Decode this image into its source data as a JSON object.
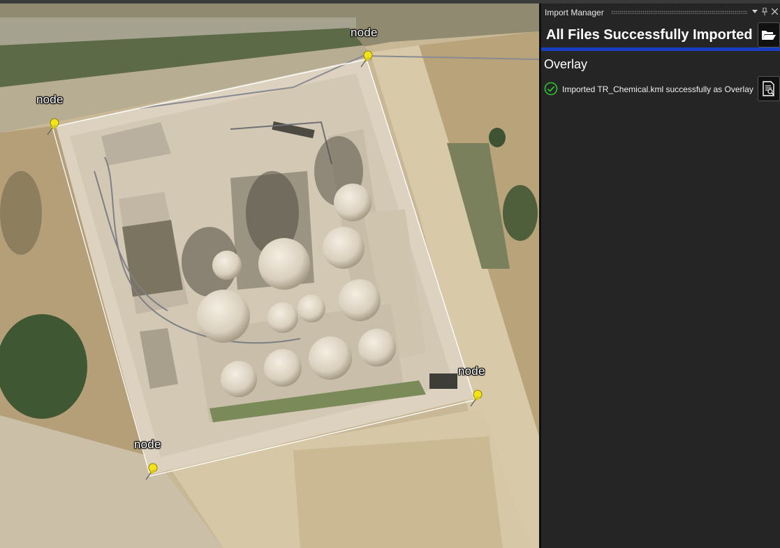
{
  "map": {
    "pins": [
      {
        "label": "node"
      },
      {
        "label": "node"
      },
      {
        "label": "node"
      },
      {
        "label": "node"
      }
    ],
    "overlay_outline_color": "#ffffff",
    "pin_color": "#f2e31b"
  },
  "panel": {
    "title": "Import Manager",
    "title_icons": [
      "dropdown-icon",
      "pin-icon",
      "close-icon"
    ],
    "header": "All Files Successfully Imported",
    "accent_color": "#1a3ec0",
    "section_title": "Overlay",
    "status_message": "Imported TR_Chemical.kml successfully as Overlay",
    "status_icon": "check-circle-icon",
    "status_color": "#2fc52f"
  }
}
